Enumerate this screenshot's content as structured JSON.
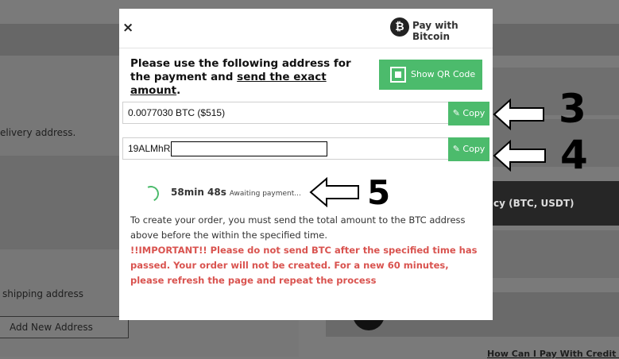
{
  "background": {
    "delivery_text": "elivery address.",
    "shipping_text": "shipping address",
    "add_address_label": "Add New Address",
    "crypto_bar_text": "cy (BTC, USDT)",
    "howcan_text": "How Can I Pay With Credit Ca"
  },
  "modal": {
    "title": "Pay with Bitcoin",
    "btc_logo": "₿",
    "close_icon": "×",
    "instruction_pre": "Please use the following address for the payment and ",
    "instruction_link": "send the exact amount",
    "instruction_post": ".",
    "qr_button_label": "Show QR Code",
    "amount_value": "0.0077030 BTC ($515)",
    "address_value": "19ALMhR",
    "copy_label": "Copy",
    "timer_value": "58min 48s",
    "timer_status": "Awaiting payment...",
    "note_text": "To create your order, you must send the total amount to the BTC address above before the within the specified time.",
    "warning_text": "!!IMPORTANT!! Please do not send BTC after the specified time has passed. Your order will not be created. For a new 60 minutes, please refresh the page and repeat the process"
  },
  "annotations": {
    "label_3": "3",
    "label_4": "4",
    "label_5": "5"
  },
  "colors": {
    "accent_green": "#4cbb6c",
    "warning_red": "#d9534f"
  }
}
